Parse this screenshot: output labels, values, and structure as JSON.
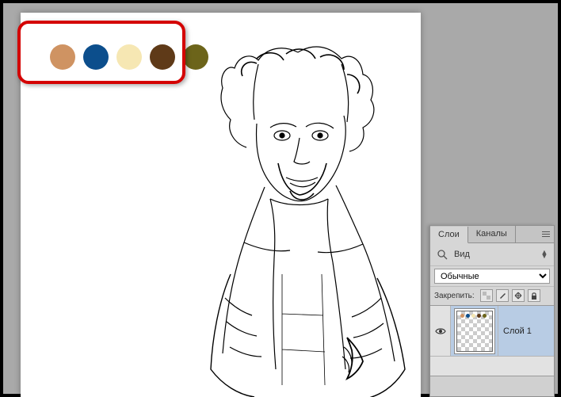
{
  "palette": {
    "colors": [
      "#cf9362",
      "#0c4e8c",
      "#f6e7b3",
      "#5f3a18",
      "#6c641a"
    ]
  },
  "panel": {
    "tabs": {
      "layers": "Слои",
      "channels": "Каналы"
    },
    "filter_label": "Вид",
    "blend_mode": "Обычные",
    "lock_label": "Закрепить:",
    "layer": {
      "name": "Слой 1"
    }
  }
}
